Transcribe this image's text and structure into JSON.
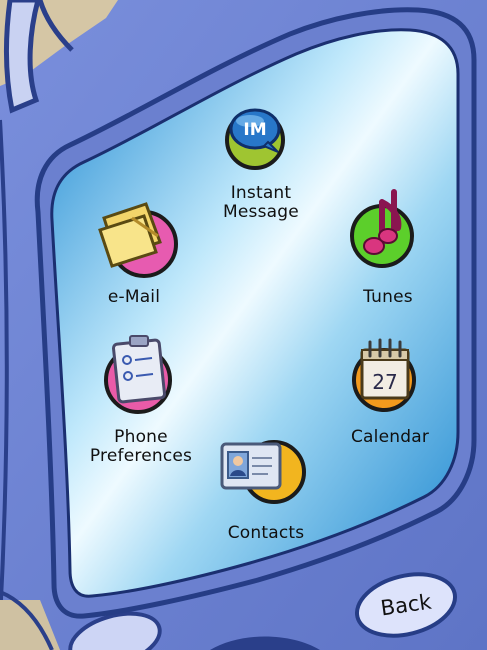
{
  "menu": {
    "items": [
      {
        "id": "instant-message",
        "label_line1": "Instant",
        "label_line2": "Message",
        "badge": "IM",
        "icon": "im-bubble-icon"
      },
      {
        "id": "email",
        "label": "e-Mail",
        "icon": "folder-icon"
      },
      {
        "id": "tunes",
        "label": "Tunes",
        "icon": "music-note-icon"
      },
      {
        "id": "phone-preferences",
        "label_line1": "Phone",
        "label_line2": "Preferences",
        "icon": "clipboard-icon"
      },
      {
        "id": "calendar",
        "label": "Calendar",
        "calendar_day": "27",
        "icon": "calendar-icon"
      },
      {
        "id": "contacts",
        "label": "Contacts",
        "icon": "contact-card-icon"
      }
    ]
  },
  "controls": {
    "back_label": "Back"
  },
  "colors": {
    "phone_body": "#6d83d3",
    "phone_outline": "#263d86",
    "screen_light": "#e7f7ff",
    "screen_dark": "#1f8fd6",
    "im_ring": "#9fc531",
    "email_ring": "#e75bb0",
    "tunes_ring": "#5ccf2b",
    "prefs_ring": "#e95ba8",
    "calendar_ring": "#f39a1d",
    "contacts_ring": "#f2b51f"
  }
}
